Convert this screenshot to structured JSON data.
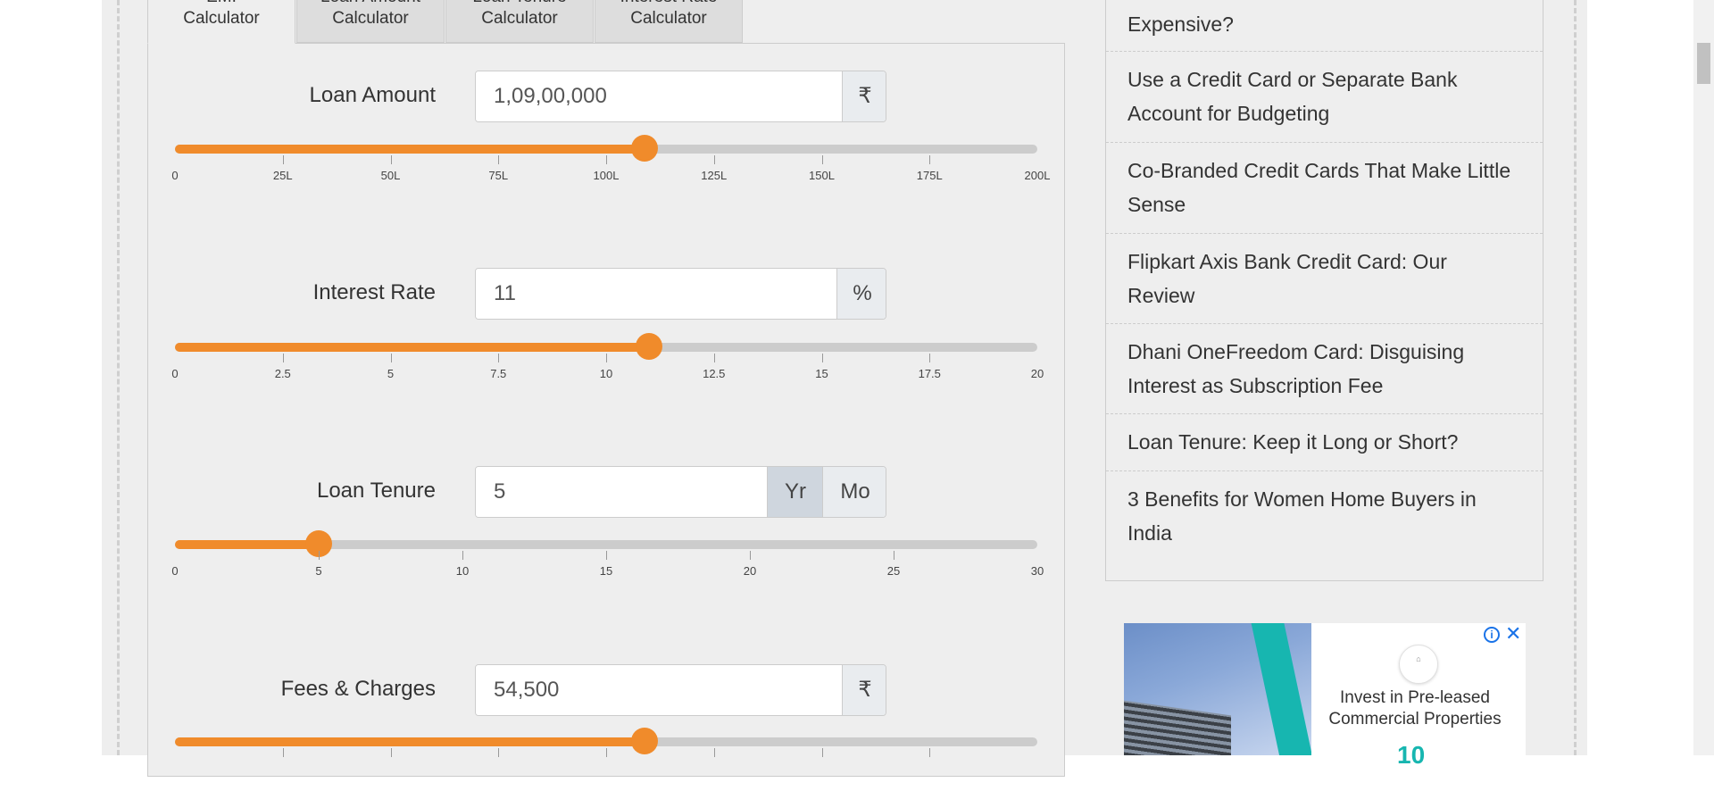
{
  "tabs": [
    {
      "label_line1": "EMI",
      "label_line2": "Calculator"
    },
    {
      "label_line1": "Loan Amount",
      "label_line2": "Calculator"
    },
    {
      "label_line1": "Loan Tenure",
      "label_line2": "Calculator"
    },
    {
      "label_line1": "Interest Rate",
      "label_line2": "Calculator"
    }
  ],
  "loan_amount": {
    "label": "Loan Amount",
    "value": "1,09,00,000",
    "unit": "₹",
    "slider_fraction": 0.545,
    "ticks": [
      "0",
      "25L",
      "50L",
      "75L",
      "100L",
      "125L",
      "150L",
      "175L",
      "200L"
    ]
  },
  "interest_rate": {
    "label": "Interest Rate",
    "value": "11",
    "unit": "%",
    "slider_fraction": 0.55,
    "ticks": [
      "0",
      "2.5",
      "5",
      "7.5",
      "10",
      "12.5",
      "15",
      "17.5",
      "20"
    ]
  },
  "loan_tenure": {
    "label": "Loan Tenure",
    "value": "5",
    "unit_year": "Yr",
    "unit_month": "Mo",
    "slider_fraction": 0.1667,
    "ticks": [
      "0",
      "5",
      "10",
      "15",
      "20",
      "25",
      "30"
    ]
  },
  "fees": {
    "label": "Fees & Charges",
    "value": "54,500",
    "unit": "₹",
    "slider_fraction": 0.545
  },
  "sidebar": {
    "items": [
      {
        "line1": "Expensive?",
        "line2": ""
      },
      {
        "line1": "Use a Credit Card or Separate Bank",
        "line2": "Account for Budgeting"
      },
      {
        "line1": "Co-Branded Credit Cards That Make Little",
        "line2": "Sense"
      },
      {
        "line1": "Flipkart Axis Bank Credit Card: Our",
        "line2": "Review"
      },
      {
        "line1": "Dhani OneFreedom Card: Disguising",
        "line2": "Interest as Subscription Fee"
      },
      {
        "line1": "Loan Tenure: Keep it Long or Short?",
        "line2": ""
      },
      {
        "line1": "3 Benefits for Women Home Buyers in",
        "line2": "India"
      }
    ]
  },
  "ad": {
    "headline_line1": "Invest in Pre-leased",
    "headline_line2": "Commercial Properties",
    "number": "10",
    "info_icon": "info-icon",
    "close_icon": "close-icon"
  },
  "colors": {
    "accent": "#f08b2b",
    "track": "#cccccc",
    "background": "#eeeeee"
  }
}
